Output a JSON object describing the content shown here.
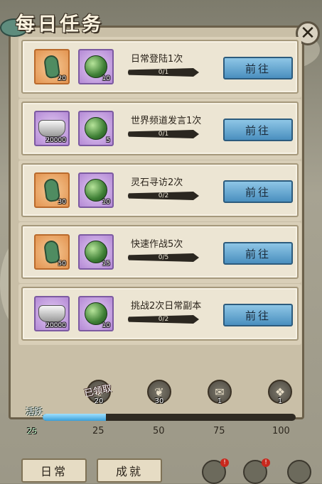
{
  "title": "每日任务",
  "close_icon": "close-icon",
  "tasks": [
    {
      "name": "日常登陆1次",
      "progress": "0/1",
      "button": "前往",
      "rewards": [
        {
          "icon": "jade-icon",
          "frame": "orange",
          "count": "20"
        },
        {
          "icon": "spirit-orb-icon",
          "frame": "purple",
          "count": "10"
        }
      ]
    },
    {
      "name": "世界频道发言1次",
      "progress": "0/1",
      "button": "前往",
      "rewards": [
        {
          "icon": "silver-ingot-icon",
          "frame": "purple",
          "count": "20000"
        },
        {
          "icon": "spirit-orb-icon",
          "frame": "purple",
          "count": "5"
        }
      ]
    },
    {
      "name": "灵石寻访2次",
      "progress": "0/2",
      "button": "前往",
      "rewards": [
        {
          "icon": "jade-icon",
          "frame": "orange",
          "count": "30"
        },
        {
          "icon": "spirit-orb-icon",
          "frame": "purple",
          "count": "10"
        }
      ]
    },
    {
      "name": "快速作战5次",
      "progress": "0/5",
      "button": "前往",
      "rewards": [
        {
          "icon": "jade-icon",
          "frame": "orange",
          "count": "50"
        },
        {
          "icon": "spirit-orb-icon",
          "frame": "purple",
          "count": "15"
        }
      ]
    },
    {
      "name": "挑战2次日常副本",
      "progress": "0/2",
      "button": "前往",
      "rewards": [
        {
          "icon": "silver-ingot-icon",
          "frame": "purple",
          "count": "20000"
        },
        {
          "icon": "spirit-orb-icon",
          "frame": "purple",
          "count": "10"
        }
      ]
    }
  ],
  "activity": {
    "label": "活跃",
    "value": "25",
    "fill_fraction": 0.25,
    "ticks": [
      "25",
      "50",
      "75",
      "100"
    ],
    "milestones": [
      {
        "icon": "jade-icon",
        "count": "20",
        "stamp": "已领取"
      },
      {
        "icon": "jade-icon",
        "count": "30"
      },
      {
        "icon": "scroll-icon",
        "count": "1"
      },
      {
        "icon": "red-book-icon",
        "count": "1"
      }
    ]
  },
  "tabs": {
    "daily": "日常",
    "achievement": "成就"
  },
  "colors": {
    "accent_button": "#4a8fbf",
    "panel": "#c9bfa7",
    "card": "#ece5d3"
  }
}
